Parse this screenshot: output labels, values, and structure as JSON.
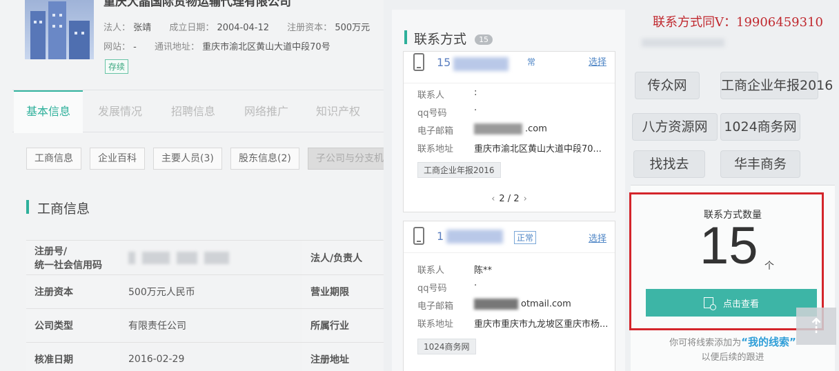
{
  "company": {
    "name": "重庆大晶国际货物运输代理有限公司",
    "legal_person_label": "法人：",
    "legal_person": "张靖",
    "founded_label": "成立日期：",
    "founded": "2004-04-12",
    "capital_label": "注册资本：",
    "capital": "500万元",
    "website_label": "网站：",
    "website": "-",
    "address_label": "通讯地址：",
    "address": "重庆市渝北区黄山大道中段70号",
    "status": "存续"
  },
  "tabs": [
    "基本信息",
    "发展情况",
    "招聘信息",
    "网络推广",
    "知识产权"
  ],
  "sub_buttons": [
    "工商信息",
    "企业百科",
    "主要人员(3)",
    "股东信息(2)",
    "子公司与分支机"
  ],
  "section_title": "工商信息",
  "table": [
    {
      "l1": "注册号/",
      "l1b": "统一社会信用码",
      "v1": "",
      "l2": "法人/负责人",
      "v2": ""
    },
    {
      "l1": "注册资本",
      "v1": "500万元人民币",
      "l2": "营业期限",
      "v2": ""
    },
    {
      "l1": "公司类型",
      "v1": "有限责任公司",
      "l2": "所属行业",
      "v2": ""
    },
    {
      "l1": "核准日期",
      "v1": "2016-02-29",
      "l2": "注册地址",
      "v2": ""
    }
  ],
  "contact_panel": {
    "title": "联系方式",
    "count": "15",
    "cards": [
      {
        "phone_prefix": "15",
        "tag": "常",
        "select": "选择",
        "labels": [
          "联系人",
          "qq号码",
          "电子邮箱",
          "联系地址"
        ],
        "contact": ":",
        "qq": "·",
        "email_suffix": ".com",
        "address": "重庆市渝北区黄山大道中段70...",
        "source": "工商企业年报2016",
        "pager": "2 / 2"
      },
      {
        "phone_prefix": "1",
        "tag": "正常",
        "select": "选择",
        "labels": [
          "联系人",
          "qq号码",
          "电子邮箱",
          "联系地址"
        ],
        "contact": "陈**",
        "qq": "·",
        "email_suffix": "otmail.com",
        "address": "重庆市重庆市九龙坡区重庆市杨...",
        "source": "1024商务网"
      }
    ]
  },
  "watermark": "联系方式同V：19906459310",
  "keywords": [
    "传众网",
    "工商企业年报2016",
    "八方资源网",
    "1024商务网",
    "找找去",
    "华丰商务"
  ],
  "count_box": {
    "title": "联系方式数量",
    "number": "15",
    "unit": "个",
    "button": "点击查看",
    "note_pre": "你可将线索添加为",
    "note_link": "“我的线索”",
    "note_post": "以便后续的跟进"
  },
  "colors": {
    "accent": "#2eb09b",
    "button": "#3db5a6",
    "highlight_border": "#d4252b",
    "link": "#4f86c6"
  }
}
